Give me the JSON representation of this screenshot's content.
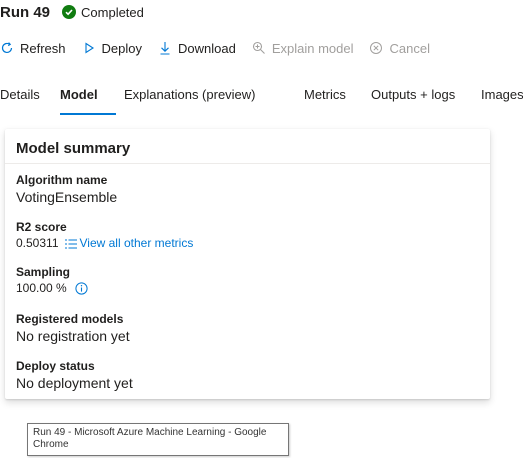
{
  "header": {
    "run_title": "Run 49",
    "status": "Completed",
    "status_color": "#107c10"
  },
  "toolbar": {
    "refresh": "Refresh",
    "deploy": "Deploy",
    "download": "Download",
    "explain_model": "Explain model",
    "cancel": "Cancel"
  },
  "tabs": [
    {
      "label": "Details"
    },
    {
      "label": "Model"
    },
    {
      "label": "Explanations (preview)"
    },
    {
      "label": "Metrics"
    },
    {
      "label": "Outputs + logs"
    },
    {
      "label": "Images"
    }
  ],
  "active_tab": "Model",
  "accent_color": "#0078d4",
  "model_summary": {
    "title": "Model summary",
    "algorithm": {
      "label": "Algorithm name",
      "value": "VotingEnsemble"
    },
    "r2": {
      "label": "R2 score",
      "value": "0.50311",
      "link": "View all other metrics"
    },
    "sampling": {
      "label": "Sampling",
      "value": "100.00 %"
    },
    "registered_models": {
      "label": "Registered models",
      "value": "No registration yet"
    },
    "deploy_status": {
      "label": "Deploy status",
      "value": "No deployment yet"
    }
  },
  "tooltip": {
    "text": "Run 49 - Microsoft Azure Machine Learning - Google Chrome"
  }
}
